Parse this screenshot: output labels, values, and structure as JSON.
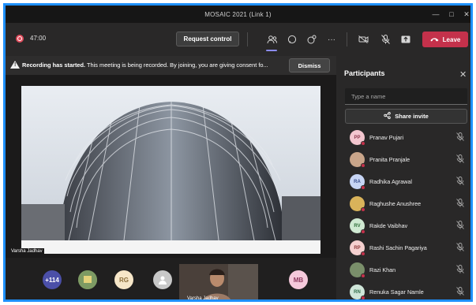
{
  "window": {
    "title": "MOSAIC 2021 (Link 1)",
    "controls": [
      "minimize",
      "maximize",
      "close"
    ]
  },
  "toolbar": {
    "timer": "47:00",
    "request_control_label": "Request control",
    "leave_label": "Leave",
    "icons": [
      "participants-icon",
      "chat-icon",
      "reactions-icon",
      "more-icon",
      "camera-off-icon",
      "mic-off-icon",
      "share-tray-icon"
    ]
  },
  "notice": {
    "bold": "Recording has started.",
    "text": "This meeting is being recorded. By joining, you are giving consent fo...",
    "dismiss_label": "Dismiss"
  },
  "stage": {
    "presenter_name": "Varsha Jadhav"
  },
  "gallery": {
    "overflow_count": "+114",
    "tiles": [
      {
        "initials": "RG",
        "color": "#f6e6c8",
        "text_color": "#8a6d3b"
      },
      {
        "initials": "MB",
        "color": "#f5c9db",
        "text_color": "#8e3a5f"
      }
    ],
    "video_name": "Varsha Jadhav"
  },
  "participants": {
    "title": "Participants",
    "search_placeholder": "Type a name",
    "share_invite_label": "Share invite",
    "list": [
      {
        "initials": "PP",
        "name": "Pranav Pujari",
        "color": "#f3c6cf",
        "text_color": "#8e3a4f"
      },
      {
        "initials": "",
        "name": "Pranita Pranjale",
        "color": "#c9a58a",
        "text_color": "#ffffff",
        "photo": true
      },
      {
        "initials": "RA",
        "name": "Radhika Agrawal",
        "color": "#c7d5f5",
        "text_color": "#3a4f8e"
      },
      {
        "initials": "",
        "name": "Raghushe Anushree",
        "color": "#d9b35a",
        "text_color": "#ffffff",
        "photo": true
      },
      {
        "initials": "RV",
        "name": "Rakde Vaibhav",
        "color": "#cfe9d2",
        "text_color": "#2f6e3a"
      },
      {
        "initials": "RP",
        "name": "Rashi Sachin Pagariya",
        "color": "#f5d0cf",
        "text_color": "#8e3a3a"
      },
      {
        "initials": "",
        "name": "Razi Khan",
        "color": "#7a8f6a",
        "text_color": "#ffffff",
        "photo": true
      },
      {
        "initials": "RN",
        "name": "Renuka Sagar Namle",
        "color": "#cfe6d9",
        "text_color": "#2f6e4a"
      }
    ]
  }
}
